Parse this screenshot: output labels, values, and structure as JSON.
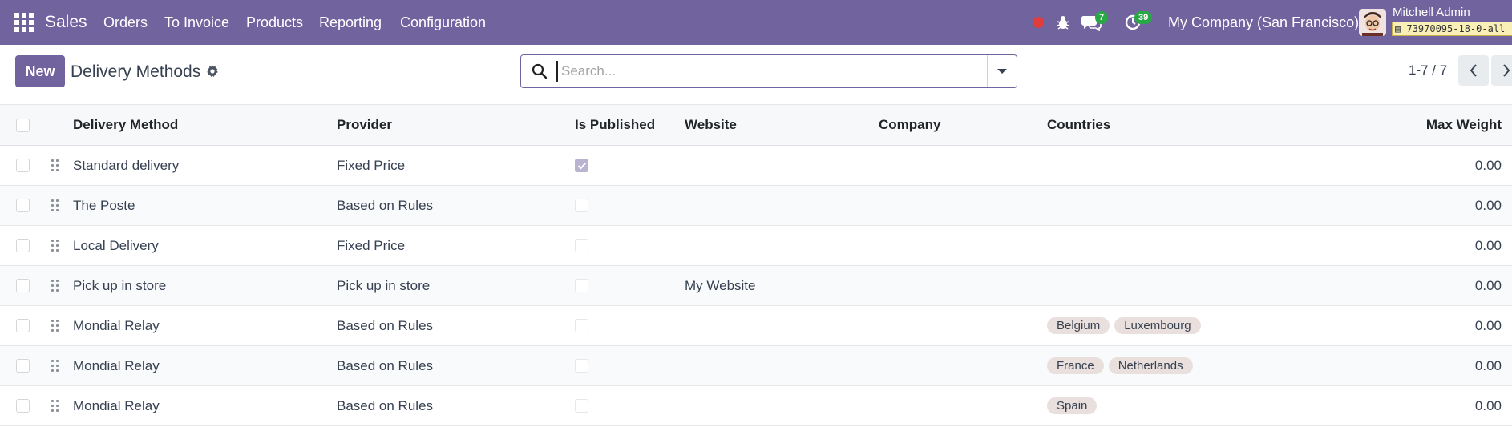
{
  "navbar": {
    "app_name": "Sales",
    "menu": [
      "Orders",
      "To Invoice",
      "Products",
      "Reporting",
      "Configuration"
    ],
    "messages_count": "7",
    "activities_count": "39",
    "company": "My Company (San Francisco)",
    "user_name": "Mitchell Admin",
    "db_name": "73970095-18-0-all"
  },
  "control": {
    "new_label": "New",
    "title": "Delivery Methods",
    "search_placeholder": "Search...",
    "pager": "1-7 / 7"
  },
  "table": {
    "headers": {
      "method": "Delivery Method",
      "provider": "Provider",
      "published": "Is Published",
      "website": "Website",
      "company": "Company",
      "countries": "Countries",
      "max_weight": "Max Weight"
    },
    "rows": [
      {
        "method": "Standard delivery",
        "provider": "Fixed Price",
        "published": true,
        "website": "",
        "company": "",
        "countries": [],
        "max_weight": "0.00"
      },
      {
        "method": "The Poste",
        "provider": "Based on Rules",
        "published": false,
        "website": "",
        "company": "",
        "countries": [],
        "max_weight": "0.00"
      },
      {
        "method": "Local Delivery",
        "provider": "Fixed Price",
        "published": false,
        "website": "",
        "company": "",
        "countries": [],
        "max_weight": "0.00"
      },
      {
        "method": "Pick up in store",
        "provider": "Pick up in store",
        "published": false,
        "website": "My Website",
        "company": "",
        "countries": [],
        "max_weight": "0.00"
      },
      {
        "method": "Mondial Relay",
        "provider": "Based on Rules",
        "published": false,
        "website": "",
        "company": "",
        "countries": [
          "Belgium",
          "Luxembourg"
        ],
        "max_weight": "0.00"
      },
      {
        "method": "Mondial Relay",
        "provider": "Based on Rules",
        "published": false,
        "website": "",
        "company": "",
        "countries": [
          "France",
          "Netherlands"
        ],
        "max_weight": "0.00"
      },
      {
        "method": "Mondial Relay",
        "provider": "Based on Rules",
        "published": false,
        "website": "",
        "company": "",
        "countries": [
          "Spain"
        ],
        "max_weight": "0.00"
      }
    ]
  },
  "colors": {
    "brand": "#71639e",
    "badge": "#28a745",
    "record_dot": "#e03c3c"
  }
}
